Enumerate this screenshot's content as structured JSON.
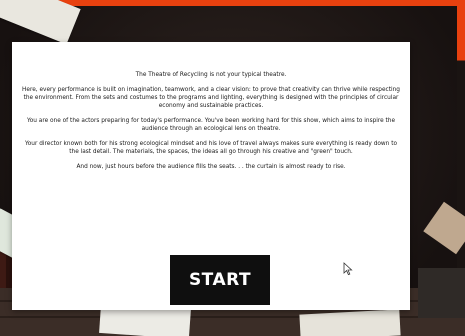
{
  "dialog": {
    "paragraphs": [
      "The Theatre of Recycling is not your typical theatre.",
      "Here, every performance is built on imagination, teamwork, and a clear vision: to prove that creativity can thrive while respecting the environment. From the sets and costumes to the programs and lighting, everything is designed with the principles of circular economy and sustainable practices.",
      "You are one of the actors preparing for today's performance. You've been working hard for this show, which aims to inspire the audience through an ecological lens on theatre.",
      "Your director known both for his strong ecological mindset and his love of travel always makes sure everything is ready down to the last detail. The materials, the spaces, the ideas all go through his creative and \"green\" touch.",
      "And now, just hours before the audience fills the seats. . . the curtain is almost ready to rise."
    ],
    "start_label": "START"
  },
  "colors": {
    "accent": "#e8410f",
    "dialog_bg": "#ffffff",
    "button_bg": "#0f0f0f",
    "button_text": "#ffffff"
  },
  "icons": {
    "cursor": "mouse-pointer-icon"
  }
}
